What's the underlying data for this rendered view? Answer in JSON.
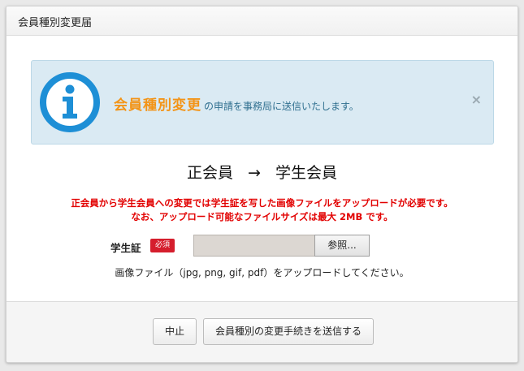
{
  "header": {
    "title": "会員種別変更届"
  },
  "alert": {
    "highlight": "会員種別変更",
    "message": "の申請を事務局に送信いたします。",
    "close_symbol": "×",
    "icon": "info-icon"
  },
  "membership_change": {
    "from": "正会員",
    "arrow": "→",
    "to": "学生会員"
  },
  "warning": {
    "line1": "正会員から学生会員への変更では学生証を写した画像ファイルをアップロードが必要です。",
    "line2": "なお、アップロード可能なファイルサイズは最大 2MB です。"
  },
  "form": {
    "label": "学生証",
    "required_badge": "必須",
    "browse_label": "参照...",
    "help_text": "画像ファイル（jpg, png, gif, pdf）をアップロードしてください。"
  },
  "footer": {
    "cancel_label": "中止",
    "submit_label": "会員種別の変更手続きを送信する"
  },
  "colors": {
    "accent_orange": "#f39417",
    "warning_red": "#e20000",
    "info_blue": "#1e8fd6",
    "alert_bg": "#daeaf3"
  }
}
